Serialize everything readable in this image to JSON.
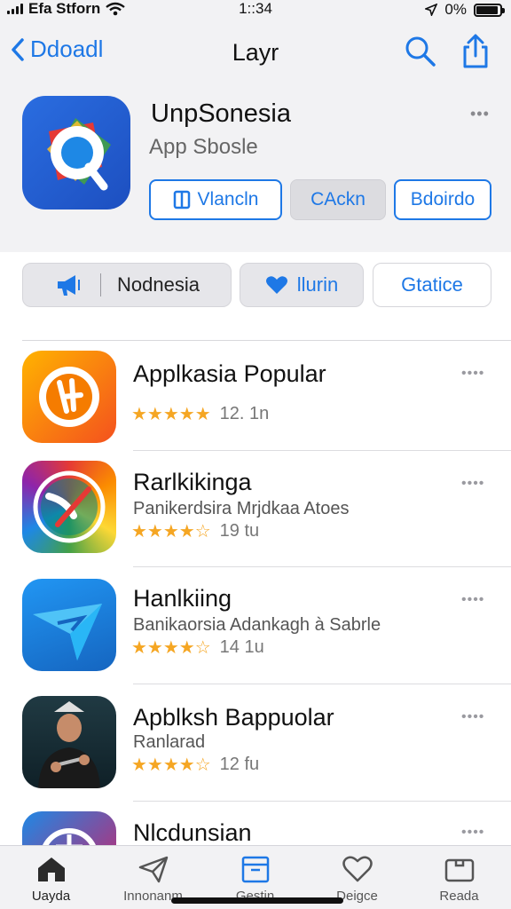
{
  "status_bar": {
    "carrier": "Efa Stforn",
    "time": "1::34",
    "battery_text": "0%"
  },
  "nav": {
    "back_label": "Ddoadl",
    "title": "Layr"
  },
  "hero": {
    "title": "UnpSonesia",
    "subtitle": "App Sbosle",
    "more": "•••",
    "buttons": [
      {
        "label": "Vlancln",
        "icon": "book-icon"
      },
      {
        "label": "CAckn"
      },
      {
        "label": "Bdoirdo"
      }
    ]
  },
  "chips": [
    {
      "label": "Nodnesia",
      "icon": "megaphone-icon"
    },
    {
      "label": "llurin",
      "icon": "heart-icon"
    },
    {
      "label": "Gtatice"
    }
  ],
  "apps": [
    {
      "name": "Applkasia Popular",
      "desc": "",
      "stars": "★★★★★",
      "rating_count": "12. 1n",
      "more": "••••"
    },
    {
      "name": "Rarlkikinga",
      "desc": "Panikerdsira Mrjdkaa Atoes",
      "stars": "★★★★☆",
      "rating_count": "19 tu",
      "more": "••••"
    },
    {
      "name": "Hanlkiing",
      "desc": "Banikaorsia Adankagh à Sabrle",
      "stars": "★★★★☆",
      "rating_count": "14 1u",
      "more": "••••"
    },
    {
      "name": "Apblksh Bappuolar",
      "desc": "Ranlarad",
      "stars": "★★★★☆",
      "rating_count": "12 fu",
      "more": "••••"
    },
    {
      "name": "Nlcdunsian",
      "desc": "",
      "stars": "",
      "rating_count": "",
      "more": "••••"
    }
  ],
  "tabs": [
    {
      "label": "Uayda",
      "icon": "house-icon"
    },
    {
      "label": "Innonanm",
      "icon": "paper-plane-icon"
    },
    {
      "label": "Gestin",
      "icon": "archive-box-icon"
    },
    {
      "label": "Deigce",
      "icon": "heart-outline-icon"
    },
    {
      "label": "Reada",
      "icon": "folder-icon"
    }
  ],
  "colors": {
    "accent": "#1e78e6",
    "star": "#f5a623",
    "header_bg": "#f2f2f4"
  }
}
